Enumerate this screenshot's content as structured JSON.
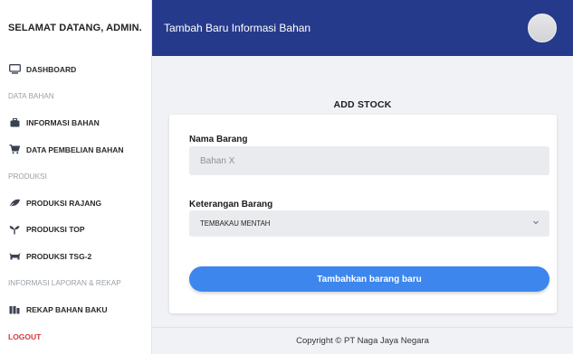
{
  "sidebar": {
    "welcome": "SELAMAT DATANG, ADMIN.",
    "items": [
      {
        "type": "item",
        "label": "DASHBOARD",
        "icon": "monitor-icon"
      },
      {
        "type": "section",
        "label": "DATA BAHAN"
      },
      {
        "type": "item",
        "label": "INFORMASI BAHAN",
        "icon": "briefcase-icon"
      },
      {
        "type": "item",
        "label": "DATA PEMBELIAN BAHAN",
        "icon": "cart-icon"
      },
      {
        "type": "section",
        "label": "PRODUKSI"
      },
      {
        "type": "item",
        "label": "PRODUKSI RAJANG",
        "icon": "leaf-icon"
      },
      {
        "type": "item",
        "label": "PRODUKSI TOP",
        "icon": "sprout-icon"
      },
      {
        "type": "item",
        "label": "PRODUKSI TSG-2",
        "icon": "cattle-icon"
      },
      {
        "type": "section",
        "label": "INFORMASI LAPORAN & REKAP"
      },
      {
        "type": "item",
        "label": "REKAP BAHAN BAKU",
        "icon": "boxes-icon"
      },
      {
        "type": "item",
        "label": "LOGOUT",
        "icon": "",
        "color": "#d63b3b"
      }
    ]
  },
  "header": {
    "title": "Tambah Baru Informasi Bahan",
    "background": "#263a8c"
  },
  "form": {
    "title": "ADD STOCK",
    "name_label": "Nama Barang",
    "name_placeholder": "Bahan X",
    "desc_label": "Keterangan Barang",
    "desc_selected": "TEMBAKAU MENTAH",
    "submit_label": "Tambahkan barang baru",
    "accent": "#3d86ee"
  },
  "footer": {
    "copyright": "Copyright © PT Naga Jaya Negara"
  }
}
